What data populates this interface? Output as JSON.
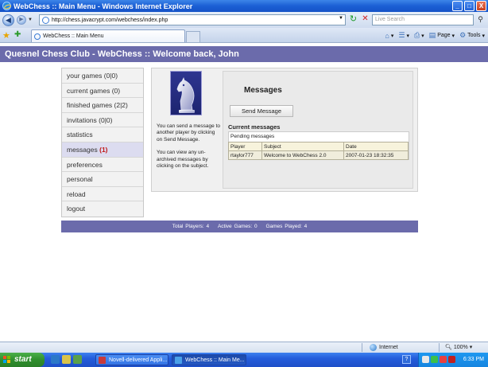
{
  "window": {
    "title": "WebChess :: Main Menu - Windows Internet Explorer",
    "minimize_glyph": "_",
    "maximize_glyph": "□",
    "close_glyph": "X"
  },
  "addressbar": {
    "url": "http://chess.javacrypt.com/webchess/index.php",
    "search_placeholder": "Live Search"
  },
  "tabs": [
    {
      "label": "WebChess :: Main Menu"
    }
  ],
  "commandbar": {
    "page_label": "Page",
    "tools_label": "Tools"
  },
  "site": {
    "header": "Quesnel Chess Club - WebChess :: Welcome back, John"
  },
  "menu": {
    "items": [
      {
        "label": "your games (0|0)"
      },
      {
        "label": "current games (0)"
      },
      {
        "label": "finished games (2|2)"
      },
      {
        "label": "invitations (0|0)"
      },
      {
        "label": "statistics"
      },
      {
        "label": "messages",
        "count": "(1)"
      },
      {
        "label": "preferences"
      },
      {
        "label": "personal"
      },
      {
        "label": "reload"
      },
      {
        "label": "logout"
      }
    ],
    "active_item": "messages"
  },
  "sidebar_text": {
    "send_help": "You can send a message to another player by clicking on Send Message.",
    "view_help": "You can view any un-archived messages by clicking on the subject."
  },
  "messages": {
    "title": "Messages",
    "send_button": "Send Message",
    "current_heading": "Current messages",
    "pending_caption": "Pending messages",
    "columns": [
      "Player",
      "Subject",
      "Date"
    ],
    "rows": [
      {
        "player": "rtaylor777",
        "subject": "Welcome to WebChess 2.0",
        "date": "2007-01-23 18:32:35"
      }
    ]
  },
  "stats": {
    "total_players": "Total Players: 4",
    "active_games": "Active Games: 0",
    "games_played": "Games Played: 4"
  },
  "statusbar": {
    "zone": "Internet",
    "zoom": "100%"
  },
  "taskbar": {
    "start_label": "start",
    "items": [
      {
        "label": "Novell-delivered Appli..."
      },
      {
        "label": "WebChess :: Main Me..."
      }
    ],
    "help_glyph": "?",
    "clock": "6:33 PM"
  },
  "colors": {
    "header_band": "#6b6bab",
    "unread_count": "#c01818"
  }
}
